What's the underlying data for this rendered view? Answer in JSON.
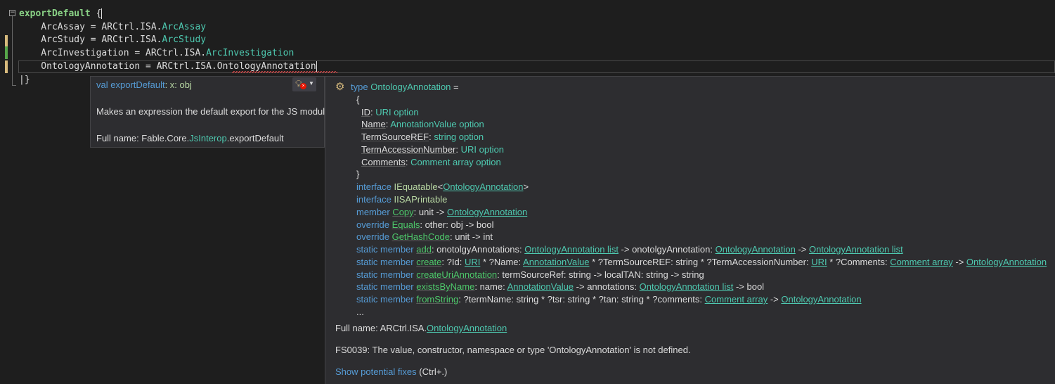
{
  "code": {
    "line1": {
      "kw": "exportDefault",
      "rest": " {"
    },
    "line2": {
      "left": "    ArcAssay = ARCtrl.ISA.",
      "type": "ArcAssay"
    },
    "line3": {
      "left": "    ArcStudy = ARCtrl.ISA.",
      "type": "ArcStudy"
    },
    "line4": {
      "left": "    ArcInvestigation = ARCtrl.ISA.",
      "type": "ArcInvestigation"
    },
    "line5": {
      "left": "    OntologyAnnotation = ARCtrl.ISA.",
      "type": "OntologyAnnotation"
    },
    "line6": {
      "text": "|}"
    }
  },
  "quickinfo": {
    "sig_kw": "val",
    "sig_name": "exportDefault",
    "sig_rest": ": x: obj",
    "description": "Makes an expression the default export for the JS module",
    "fullname_prefix": "Full name: Fable.Core.",
    "fullname_link": "JsInterop",
    "fullname_suffix": ".exportDefault"
  },
  "tooltip": {
    "l0_kw": "type",
    "l0_name": "OntologyAnnotation",
    "l0_rest": " =",
    "l1": "{",
    "fields": [
      {
        "name": "ID",
        "type": "URI option"
      },
      {
        "name": "Name",
        "type": "AnnotationValue option"
      },
      {
        "name": "TermSourceREF",
        "type": "string option"
      },
      {
        "name": "TermAccessionNumber",
        "type": "URI option"
      },
      {
        "name": "Comments",
        "type": "Comment array option"
      }
    ],
    "l7": "}",
    "iface1_kw": "interface",
    "iface1_name": "IEquatable",
    "iface1_arg": "OntologyAnnotation",
    "iface2_kw": "interface",
    "iface2_name": "IISAPrintable",
    "m1_kw": "member",
    "m1_name": "Copy",
    "m1_sig": ": unit -> ",
    "m1_ret": "OntologyAnnotation",
    "m2_kw": "override",
    "m2_name": "Equals",
    "m2_sig": ": other: obj -> bool",
    "m3_kw": "override",
    "m3_name": "GetHashCode",
    "m3_sig": ": unit -> int",
    "s1_kw": "static member",
    "s1_name": "add",
    "s1_a": ": onotolgyAnnotations: ",
    "s1_b": "OntologyAnnotation list",
    "s1_c": " -> onotolgyAnnotation: ",
    "s1_d": "OntologyAnnotation",
    "s1_e": " -> ",
    "s1_f": "OntologyAnnotation list",
    "s2_kw": "static member",
    "s2_name": "create",
    "s2_a": ": ?Id: ",
    "s2_b": "URI",
    "s2_c": " * ?Name: ",
    "s2_d": "AnnotationValue",
    "s2_e": " * ?TermSourceREF: string * ?TermAccessionNumber: ",
    "s2_f": "URI",
    "s2_g": " * ?Comments: ",
    "s2_h": "Comment array",
    "s2_i": " -> ",
    "s2_j": "OntologyAnnotation",
    "s3_kw": "static member",
    "s3_name": "createUriAnnotation",
    "s3_sig": ": termSourceRef: string -> localTAN: string -> string",
    "s4_kw": "static member",
    "s4_name": "existsByName",
    "s4_a": ": name: ",
    "s4_b": "AnnotationValue",
    "s4_c": " -> annotations: ",
    "s4_d": "OntologyAnnotation list",
    "s4_e": " -> bool",
    "s5_kw": "static member",
    "s5_name": "fromString",
    "s5_a": ": ?termName: string * ?tsr: string * ?tan: string * ?comments: ",
    "s5_b": "Comment array",
    "s5_c": " -> ",
    "s5_d": "OntologyAnnotation",
    "ellipsis": "...",
    "fullname_prefix": "Full name: ARCtrl.ISA.",
    "fullname_link": "OntologyAnnotation",
    "error": "FS0039: The value, constructor, namespace or type 'OntologyAnnotation' is not defined.",
    "fix_link": "Show potential fixes",
    "fix_shortcut": " (Ctrl+.)"
  }
}
